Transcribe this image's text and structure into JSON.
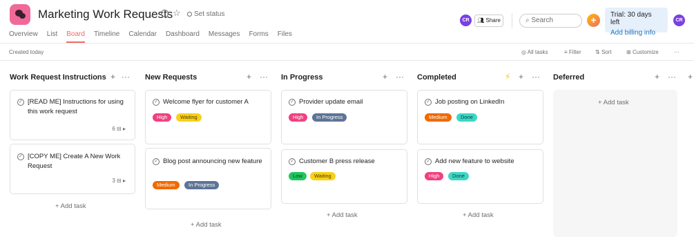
{
  "project": {
    "title": "Marketing Work Requests",
    "set_status": "Set status"
  },
  "tabs": [
    "Overview",
    "List",
    "Board",
    "Timeline",
    "Calendar",
    "Dashboard",
    "Messages",
    "Forms",
    "Files"
  ],
  "active_tab": "Board",
  "header_right": {
    "avatar": "CR",
    "share": "Share",
    "search_placeholder": "Search",
    "trial_line1": "Trial: 30 days left",
    "trial_line2": "Add billing info",
    "user_avatar": "CR"
  },
  "toolbar": {
    "created": "Created today",
    "all_tasks": "All tasks",
    "filter": "Filter",
    "sort": "Sort",
    "customize": "Customize",
    "more": "···"
  },
  "colors": {
    "accent": "#f06a6a",
    "high": "#f0407f",
    "medium": "#f06a00",
    "low": "#22c55e",
    "waiting": "#f9d01a",
    "done": "#3dd6c5",
    "in_progress": "#5e7496"
  },
  "columns": [
    {
      "title": "Work Request Instructions",
      "cards": [
        {
          "title": "[READ ME] Instructions for using this work request",
          "meta": "6 ⊟ ▸",
          "tags": []
        },
        {
          "title": "[COPY ME] Create A New Work Request",
          "meta": "3 ⊟ ▸",
          "tags": []
        }
      ],
      "add_task": "+ Add task"
    },
    {
      "title": "New Requests",
      "cards": [
        {
          "title": "Welcome flyer for customer A",
          "tags": [
            "High",
            "Waiting"
          ]
        },
        {
          "title": "Blog post announcing new feature",
          "tags": [
            "Medium",
            "In Progress"
          ]
        }
      ],
      "add_task": "+ Add task"
    },
    {
      "title": "In Progress",
      "cards": [
        {
          "title": "Provider update email",
          "tags": [
            "High",
            "In Progress"
          ]
        },
        {
          "title": "Customer B press release",
          "tags": [
            "Low",
            "Waiting"
          ]
        }
      ],
      "add_task": "+ Add task"
    },
    {
      "title": "Completed",
      "cards": [
        {
          "title": "Job posting on LinkedIn",
          "tags": [
            "Medium",
            "Done"
          ]
        },
        {
          "title": "Add new feature to website",
          "tags": [
            "High",
            "Done"
          ]
        }
      ],
      "add_task": "+ Add task"
    },
    {
      "title": "Deferred",
      "cards": [],
      "add_task": "+ Add task"
    }
  ]
}
